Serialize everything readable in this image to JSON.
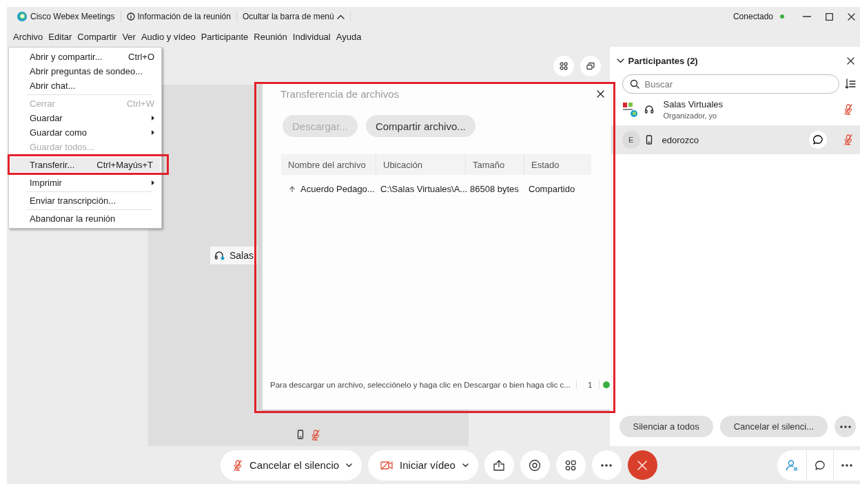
{
  "app": {
    "title": "Cisco Webex Meetings",
    "info": "Información de la reunión",
    "hide_menu": "Ocultar la barra de menú",
    "status": "Conectado",
    "connected": true
  },
  "menu_bar": [
    "Archivo",
    "Editar",
    "Compartir",
    "Ver",
    "Audio y vídeo",
    "Participante",
    "Reunión",
    "Individual",
    "Ayuda"
  ],
  "file_menu": {
    "items": [
      {
        "kind": "item",
        "label": "Abrir y compartir...",
        "shortcut": "Ctrl+O",
        "disabled": false,
        "submenu": false,
        "selected": false
      },
      {
        "kind": "item",
        "label": "Abrir preguntas de sondeo...",
        "disabled": false,
        "submenu": false,
        "selected": false
      },
      {
        "kind": "item",
        "label": "Abrir chat...",
        "disabled": false,
        "submenu": false,
        "selected": false
      },
      {
        "kind": "separator"
      },
      {
        "kind": "item",
        "label": "Cerrar",
        "shortcut": "Ctrl+W",
        "disabled": true,
        "submenu": false,
        "selected": false
      },
      {
        "kind": "item",
        "label": "Guardar",
        "disabled": false,
        "submenu": true,
        "selected": false
      },
      {
        "kind": "item",
        "label": "Guardar como",
        "disabled": false,
        "submenu": true,
        "selected": false
      },
      {
        "kind": "item",
        "label": "Guardar todos...",
        "disabled": true,
        "submenu": false,
        "selected": false
      },
      {
        "kind": "separator"
      },
      {
        "kind": "item",
        "label": "Transferir...",
        "shortcut": "Ctrl+Mayús+T",
        "disabled": false,
        "submenu": false,
        "selected": true,
        "outlined": true
      },
      {
        "kind": "separator"
      },
      {
        "kind": "item",
        "label": "Imprimir",
        "disabled": false,
        "submenu": true,
        "selected": false
      },
      {
        "kind": "separator"
      },
      {
        "kind": "item",
        "label": "Enviar transcripción...",
        "disabled": false,
        "submenu": false,
        "selected": false
      },
      {
        "kind": "separator"
      },
      {
        "kind": "item",
        "label": "Abandonar la reunión",
        "disabled": false,
        "submenu": false,
        "selected": false
      }
    ]
  },
  "stage": {
    "tile_label": "Salas",
    "tile_muted": true
  },
  "file_transfer": {
    "title": "Transferencia de archivos",
    "outlined": true,
    "buttons": [
      {
        "label": "Descargar...",
        "disabled": true
      },
      {
        "label": "Compartir archivo...",
        "disabled": false
      }
    ],
    "columns": [
      "Nombre del archivo",
      "Ubicación",
      "Tamaño",
      "Estado"
    ],
    "rows": [
      {
        "cells": [
          "Acuerdo Pedago...",
          "C:\\Salas Virtuales\\A...",
          "86508 bytes",
          "Compartido"
        ]
      }
    ],
    "footer": "Para descargar un archivo, selecciónelo y haga clic en Descargar o bien haga clic c...",
    "count": "1",
    "online": true
  },
  "participants": {
    "title": "Participantes (2)",
    "search": {
      "placeholder": "Buscar"
    },
    "items": [
      {
        "kind": "host",
        "name": "Salas Virtuales",
        "role": "Organizador, yo",
        "muted": true,
        "selected": false
      },
      {
        "kind": "guest",
        "initial": "E",
        "name": "edorozco",
        "muted": true,
        "selected": true
      }
    ],
    "buttons": [
      "Silenciar a todos",
      "Cancelar el silenci..."
    ]
  },
  "toolbar": {
    "audio": {
      "label": "Cancelar el silencio",
      "muted": true
    },
    "video": {
      "label": "Iniciar vídeo",
      "on": false
    }
  }
}
